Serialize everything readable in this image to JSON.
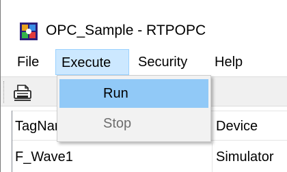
{
  "window": {
    "title": "OPC_Sample - RTPOPC",
    "icon": "opc-app-icon"
  },
  "menubar": {
    "items": [
      {
        "label": "File"
      },
      {
        "label": "Execute"
      },
      {
        "label": "Security"
      },
      {
        "label": "Help"
      }
    ],
    "active": "Execute",
    "highlight_color": "#cce8ff"
  },
  "toolbar": {
    "buttons": [
      {
        "icon": "printer-icon"
      }
    ]
  },
  "execute_menu": {
    "items": [
      {
        "label": "Run",
        "enabled": true,
        "hovered": true
      },
      {
        "label": "Stop",
        "enabled": false
      }
    ],
    "hover_color": "#91c9f7",
    "disabled_color": "#6d6d6d"
  },
  "tag_list": {
    "columns": [
      {
        "label": "TagName"
      },
      {
        "label": "Device"
      }
    ],
    "rows": [
      {
        "tagname": "F_Wave1",
        "device": "Simulator"
      }
    ]
  }
}
